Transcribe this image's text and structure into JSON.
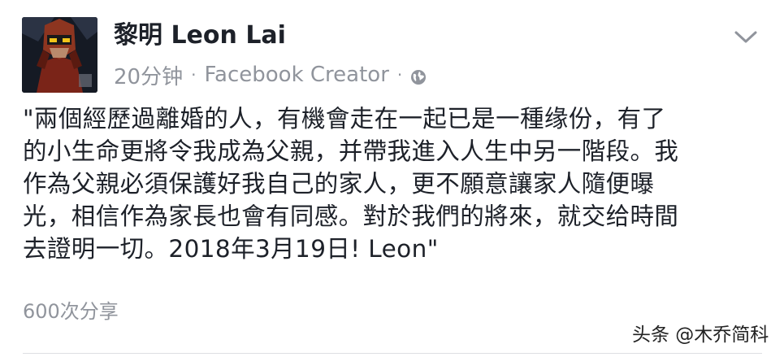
{
  "post": {
    "author_name": "黎明 Leon Lai",
    "timestamp": "20分钟",
    "separator": "·",
    "source": "Facebook Creator",
    "privacy_icon": "globe-icon",
    "menu_icon": "chevron-down-icon",
    "text_lines": [
      "\"兩個經歷過離婚的人，有機會走在一起已是一種缘份，有了",
      "的小生命更將令我成為父親，并帶我進入人生中另一階段。我",
      "作為父親必須保護好我自己的家人，更不願意讓家人隨便曝",
      "光，相信作為家長也會有同感。對於我們的將來，就交给時間",
      "去證明一切。2018年3月19日! Leon\""
    ],
    "shares": "600次分享"
  },
  "watermark": "头条 @木乔简科",
  "colors": {
    "text": "#1d2129",
    "meta": "#90949c",
    "divider": "#dddfe2",
    "background": "#ffffff"
  }
}
